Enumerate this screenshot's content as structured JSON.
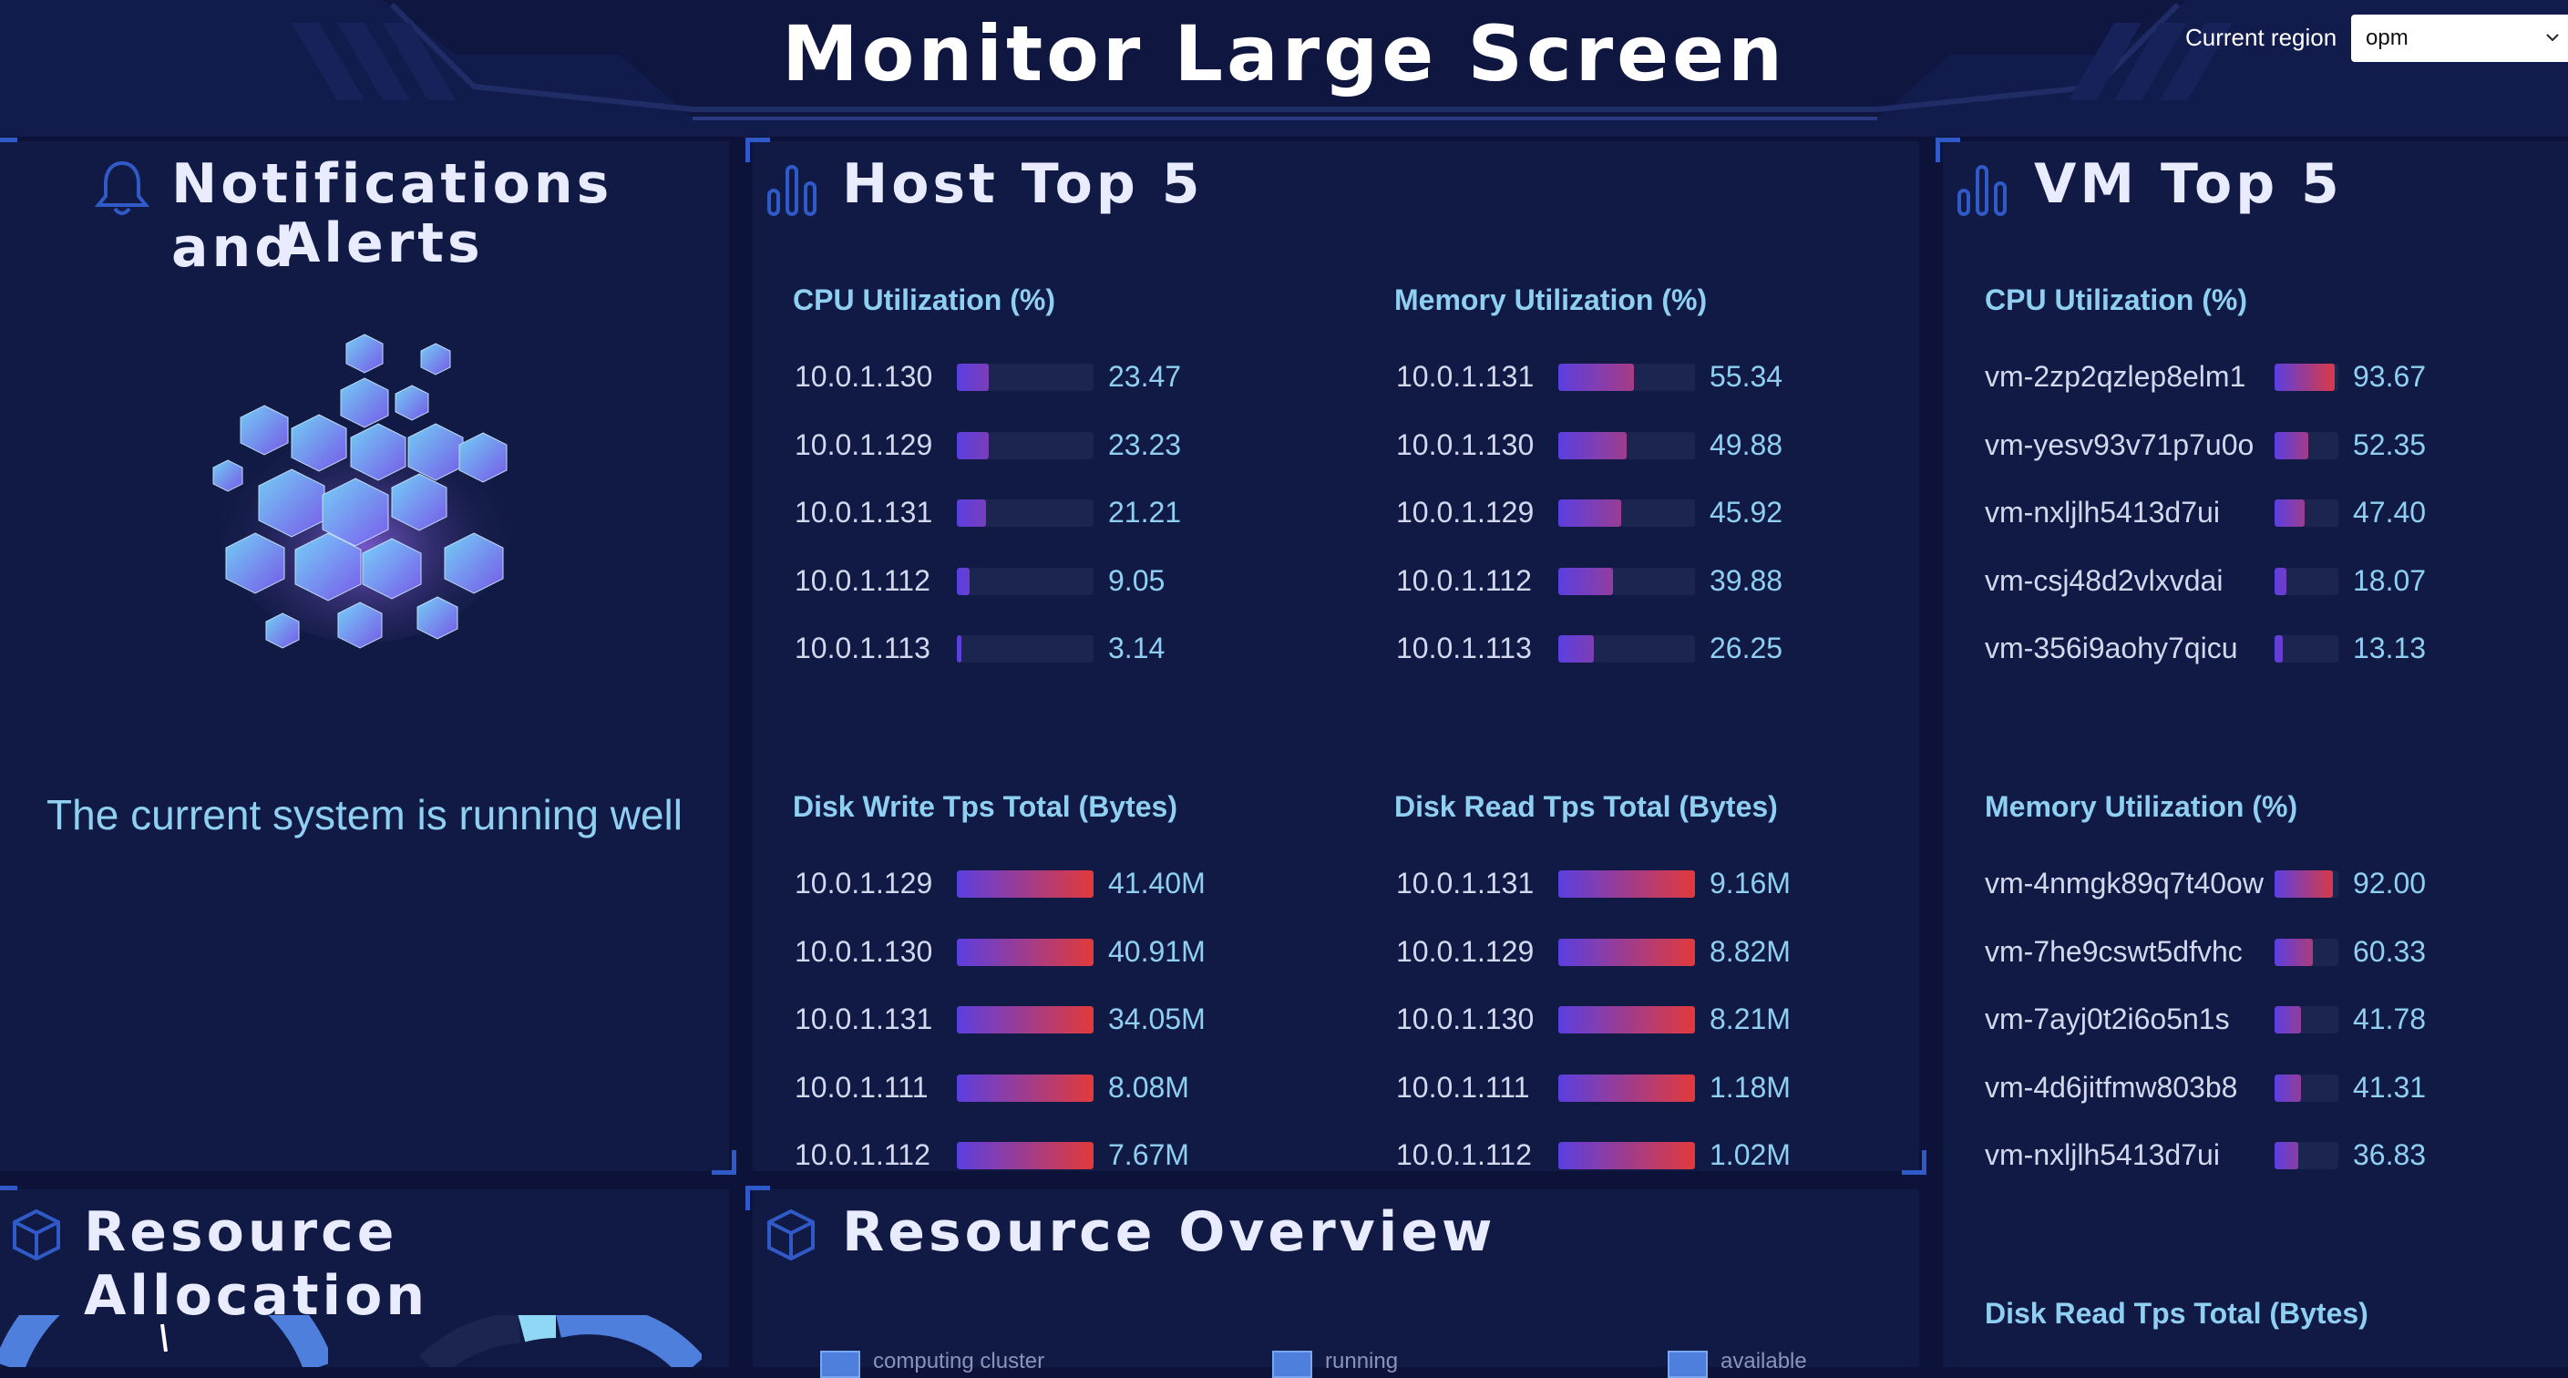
{
  "header": {
    "title": "Monitor Large Screen",
    "region_label": "Current region",
    "region_value": "opm"
  },
  "notifications": {
    "title_line1": "Notifications and",
    "title_line2": "Alerts",
    "status": "The current system is running well"
  },
  "host_top": {
    "title": "Host Top 5",
    "cpu": {
      "title": "CPU Utilization (%)",
      "rows": [
        {
          "label": "10.0.1.130",
          "value": "23.47",
          "level": 23.47
        },
        {
          "label": "10.0.1.129",
          "value": "23.23",
          "level": 23.23
        },
        {
          "label": "10.0.1.131",
          "value": "21.21",
          "level": 21.21
        },
        {
          "label": "10.0.1.112",
          "value": "9.05",
          "level": 9.05
        },
        {
          "label": "10.0.1.113",
          "value": "3.14",
          "level": 3.14
        }
      ]
    },
    "memory": {
      "title": "Memory Utilization (%)",
      "rows": [
        {
          "label": "10.0.1.131",
          "value": "55.34",
          "level": 55.34
        },
        {
          "label": "10.0.1.130",
          "value": "49.88",
          "level": 49.88
        },
        {
          "label": "10.0.1.129",
          "value": "45.92",
          "level": 45.92
        },
        {
          "label": "10.0.1.112",
          "value": "39.88",
          "level": 39.88
        },
        {
          "label": "10.0.1.113",
          "value": "26.25",
          "level": 26.25
        }
      ]
    },
    "disk_write": {
      "title": "Disk Write Tps Total (Bytes)",
      "rows": [
        {
          "label": "10.0.1.129",
          "value": "41.40M",
          "level": 100
        },
        {
          "label": "10.0.1.130",
          "value": "40.91M",
          "level": 100
        },
        {
          "label": "10.0.1.131",
          "value": "34.05M",
          "level": 100
        },
        {
          "label": "10.0.1.111",
          "value": "8.08M",
          "level": 100
        },
        {
          "label": "10.0.1.112",
          "value": "7.67M",
          "level": 100
        }
      ]
    },
    "disk_read": {
      "title": "Disk Read Tps Total (Bytes)",
      "rows": [
        {
          "label": "10.0.1.131",
          "value": "9.16M",
          "level": 100
        },
        {
          "label": "10.0.1.129",
          "value": "8.82M",
          "level": 100
        },
        {
          "label": "10.0.1.130",
          "value": "8.21M",
          "level": 100
        },
        {
          "label": "10.0.1.111",
          "value": "1.18M",
          "level": 100
        },
        {
          "label": "10.0.1.112",
          "value": "1.02M",
          "level": 100
        }
      ]
    }
  },
  "vm_top": {
    "title": "VM Top 5",
    "cpu": {
      "title": "CPU Utilization (%)",
      "rows": [
        {
          "label": "vm-2zp2qzlep8elm1",
          "value": "93.67",
          "level": 93.67
        },
        {
          "label": "vm-yesv93v71p7u0o",
          "value": "52.35",
          "level": 52.35
        },
        {
          "label": "vm-nxljlh5413d7ui",
          "value": "47.40",
          "level": 47.4
        },
        {
          "label": "vm-csj48d2vlxvdai",
          "value": "18.07",
          "level": 18.07
        },
        {
          "label": "vm-356i9aohy7qicu",
          "value": "13.13",
          "level": 13.13
        }
      ]
    },
    "memory": {
      "title": "Memory Utilization (%)",
      "rows": [
        {
          "label": "vm-4nmgk89q7t40ow",
          "value": "92.00",
          "level": 92.0
        },
        {
          "label": "vm-7he9cswt5dfvhc",
          "value": "60.33",
          "level": 60.33
        },
        {
          "label": "vm-7ayj0t2i6o5n1s",
          "value": "41.78",
          "level": 41.78
        },
        {
          "label": "vm-4d6jitfmw803b8",
          "value": "41.31",
          "level": 41.31
        },
        {
          "label": "vm-nxljlh5413d7ui",
          "value": "36.83",
          "level": 36.83
        }
      ]
    },
    "disk_read_title": "Disk Read Tps Total (Bytes)"
  },
  "resource_allocation": {
    "title": "Resource Allocation"
  },
  "resource_overview": {
    "title": "Resource Overview",
    "legend": [
      "computing cluster",
      "running",
      "available"
    ]
  },
  "colors": {
    "background": "#0d1338",
    "panel": "#111a44",
    "accent_blue": "#2f5ac7",
    "label_cyan": "#8fd0f2",
    "bar_start": "#5b3fe0",
    "bar_end": "#e23a3a"
  }
}
